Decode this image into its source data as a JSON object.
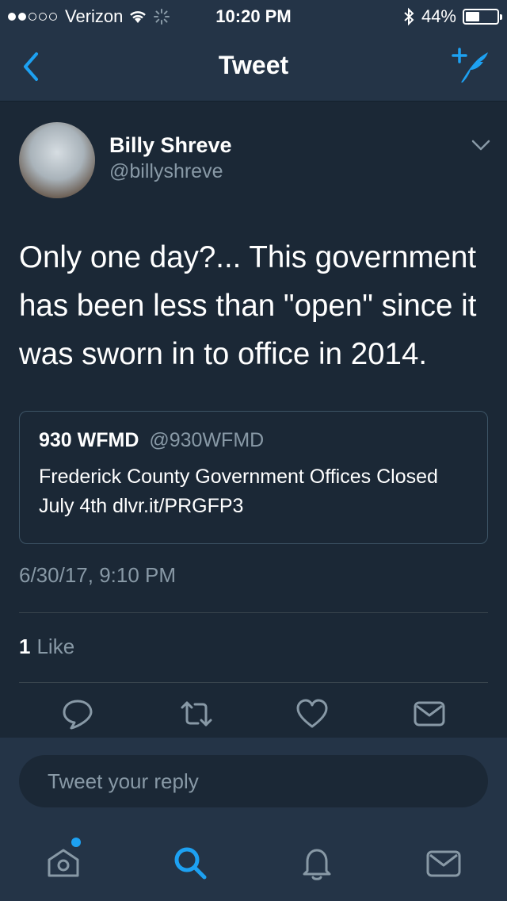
{
  "status_bar": {
    "carrier": "Verizon",
    "time": "10:20 PM",
    "battery": "44%"
  },
  "nav": {
    "title": "Tweet"
  },
  "tweet": {
    "author_name": "Billy Shreve",
    "author_handle": "@billyshreve",
    "text": "Only one day?... This government has been less than \"open\" since it was sworn in to office in 2014.",
    "timestamp": "6/30/17, 9:10 PM",
    "like_count": "1",
    "like_label": "Like"
  },
  "quoted_tweet": {
    "name": "930 WFMD",
    "handle": "@930WFMD",
    "text": "Frederick County Government Offices Closed July 4th dlvr.it/PRGFP3"
  },
  "reply": {
    "placeholder": "Tweet your reply"
  },
  "icons": {
    "back": "chevron-left-icon",
    "compose": "compose-icon",
    "reply": "reply-icon",
    "retweet": "retweet-icon",
    "like": "heart-icon",
    "dm": "mail-icon",
    "home": "home-icon",
    "search": "search-icon",
    "notifications": "bell-icon",
    "messages": "mail-icon"
  },
  "colors": {
    "accent": "#1da1f2",
    "background": "#1b2836",
    "bar": "#243447",
    "secondary_text": "#8899a6"
  }
}
